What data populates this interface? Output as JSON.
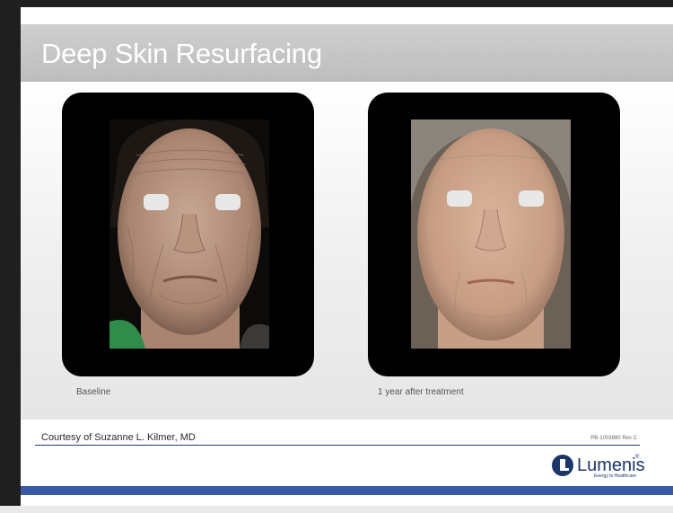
{
  "slide": {
    "title": "Deep Skin Resurfacing",
    "panels": [
      {
        "caption": "Baseline",
        "image_name": "before-face-photo"
      },
      {
        "caption": "1 year after treatment",
        "image_name": "after-face-photo"
      }
    ],
    "courtesy": "Courtesy of Suzanne L. Kilmer, MD",
    "part_number": "PB-1003880 Rev C",
    "logo": {
      "name": "Lumenis",
      "tagline": "Energy to Healthcare",
      "brand_color": "#1b3469"
    },
    "colors": {
      "title_bar": "#c6c6c6",
      "bottom_bar": "#3a5aa8",
      "rule": "#1f3c73"
    }
  }
}
